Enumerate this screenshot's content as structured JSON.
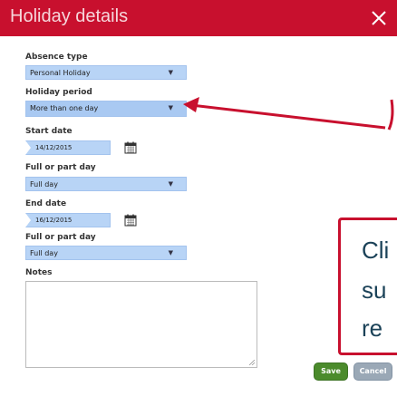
{
  "dialog": {
    "title": "Holiday details"
  },
  "colors": {
    "accent": "#c8102e",
    "field": "#b8d4f6",
    "save": "#4b8b2c",
    "cancel": "#9aa8b6"
  },
  "form": {
    "absence_type": {
      "label": "Absence type",
      "value": "Personal Holiday"
    },
    "holiday_period": {
      "label": "Holiday period",
      "value": "More than one day"
    },
    "start_date": {
      "label": "Start date",
      "value": "14/12/2015"
    },
    "start_full_or_part": {
      "label": "Full or part day",
      "value": "Full day"
    },
    "end_date": {
      "label": "End date",
      "value": "16/12/2015"
    },
    "end_full_or_part": {
      "label": "Full or part day",
      "value": "Full day"
    },
    "notes": {
      "label": "Notes",
      "value": ""
    }
  },
  "buttons": {
    "save": "Save",
    "cancel": "Cancel"
  },
  "side_text": {
    "line1": "Cli",
    "line2": "su",
    "line3": "re"
  },
  "icons": {
    "close": "close-icon",
    "calendar": "calendar-icon",
    "caret": "caret-down-icon"
  }
}
